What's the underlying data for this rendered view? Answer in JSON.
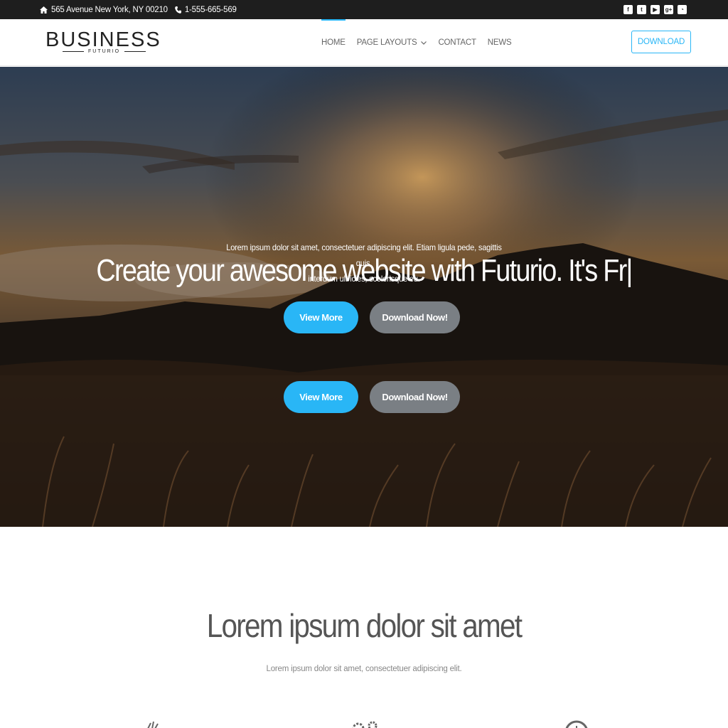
{
  "topbar": {
    "address": "565 Avenue New York, NY 00210",
    "phone": "1-555-665-569",
    "social": [
      "facebook-icon",
      "twitter-icon",
      "youtube-icon",
      "google-plus-icon",
      "rss-icon"
    ]
  },
  "header": {
    "logo_main": "BUSINESS",
    "logo_sub": "FUTURIO",
    "nav": [
      {
        "label": "HOME",
        "active": true
      },
      {
        "label": "PAGE LAYOUTS",
        "has_dropdown": true
      },
      {
        "label": "CONTACT"
      },
      {
        "label": "NEWS"
      }
    ],
    "download_label": "DOWNLOAD"
  },
  "hero": {
    "headline": "Create your awesome website with Futurio. It's Fr|",
    "subtext_line1": "Lorem ipsum dolor sit amet, consectetuer adipiscing elit. Etiam ligula pede, sagittis quis,",
    "subtext_line2": "interdum ultricies, scelerisque eu.",
    "buttons": [
      {
        "label": "View More"
      },
      {
        "label": "Download Now!"
      }
    ],
    "buttons_repeat": [
      {
        "label": "View More"
      },
      {
        "label": "Download Now!"
      }
    ]
  },
  "section": {
    "title": "Lorem ipsum dolor sit amet",
    "description": "Lorem ipsum dolor sit amet, consectetuer adipiscing elit."
  },
  "colors": {
    "accent": "#29b6f6",
    "button_grey": "#7a7f84",
    "topbar_bg": "#1e1e1e"
  }
}
